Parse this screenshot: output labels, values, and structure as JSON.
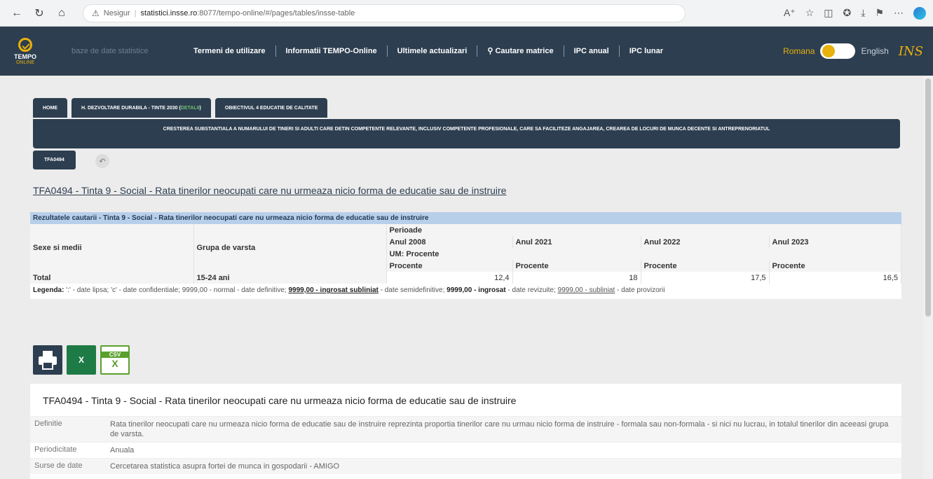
{
  "browser": {
    "security_label": "Nesigur",
    "host": "statistici.insse.ro",
    "path": ":8077/tempo-online/#/pages/tables/insse-table"
  },
  "header": {
    "logo_text": "TEMPO",
    "logo_sub": "ONLINE",
    "db_label": "baze de date statistice",
    "nav": [
      "Termeni de utilizare",
      "Informatii TEMPO-Online",
      "Ultimele actualizari",
      "Cautare matrice",
      "IPC anual",
      "IPC lunar"
    ],
    "lang_ro": "Romana",
    "lang_en": "English",
    "ins_logo": "INS",
    "accent": "#e8b10c",
    "bar_color": "#2d3e50"
  },
  "breadcrumbs": {
    "home": "HOME",
    "theme": "H. DEZVOLTARE DURABILA - TINTE 2030 (",
    "theme_detail": "DETALII",
    "theme_close": ")",
    "directive": "OBIECTIVUL 4 EDUCATIE DE CALITATE",
    "goal": "CRESTEREA SUBSTANTIALA A NUMARULUI DE TINERI SI ADULTI CARE DETIN COMPETENTE RELEVANTE, INCLUSIV COMPETENTE PROFESIONALE, CARE SA FACILITEZE ANGAJAREA, CREAREA DE LOCURI DE MUNCA DECENTE SI ANTREPRENORIATUL",
    "code": "TFA0494"
  },
  "table_title": "TFA0494 - Tinta 9 - Social - Rata tinerilor neocupati care nu urmeaza nicio forma de educatie sau de instruire",
  "results": {
    "header": "Rezultatele cautarii - Tinta 9 - Social - Rata tinerilor neocupati care nu urmeaza nicio forma de educatie sau de instruire",
    "col1": "Sexe si medii",
    "col2": "Grupa de varsta",
    "periods_label": "Perioade",
    "years": [
      "Anul 2008",
      "Anul 2021",
      "Anul 2022",
      "Anul 2023"
    ],
    "um_label": "UM: Procente",
    "unit": "Procente",
    "row_label": "Total",
    "row_group": "15-24 ani",
    "values": [
      "12,4",
      "18",
      "17,5",
      "16,5"
    ],
    "legend_label": "Legenda:",
    "legend_1": " ':' - date lipsa; 'c' - date confidentiale; 9999,00 - normal - date definitive; ",
    "legend_2": "9999,00 - ingrosat subliniat",
    "legend_3": " - date semidefinitive; ",
    "legend_4": "9999,00 - ingrosat",
    "legend_5": " - date revizuite; ",
    "legend_6": "9999,00 - subliniat",
    "legend_7": " - date provizorii"
  },
  "exports": {
    "xls_label": "X",
    "csv_top": "CSV",
    "csv_label": "X"
  },
  "meta": {
    "title": "TFA0494 - Tinta 9 - Social - Rata tinerilor neocupati care nu urmeaza nicio forma de educatie sau de instruire",
    "rows": [
      {
        "k": "Definitie",
        "v": "Rata tinerilor neocupati care nu urmeaza nicio forma de educatie sau de instruire reprezinta proportia tinerilor care nu urmau nicio forma de instruire - formala sau non-formala - si nici nu lucrau, in totalul tinerilor din aceeasi grupa de varsta."
      },
      {
        "k": "Periodicitate",
        "v": "Anuala"
      },
      {
        "k": "Surse de date",
        "v": "Cercetarea statistica asupra fortei de munca in gospodarii - AMIGO"
      }
    ]
  }
}
